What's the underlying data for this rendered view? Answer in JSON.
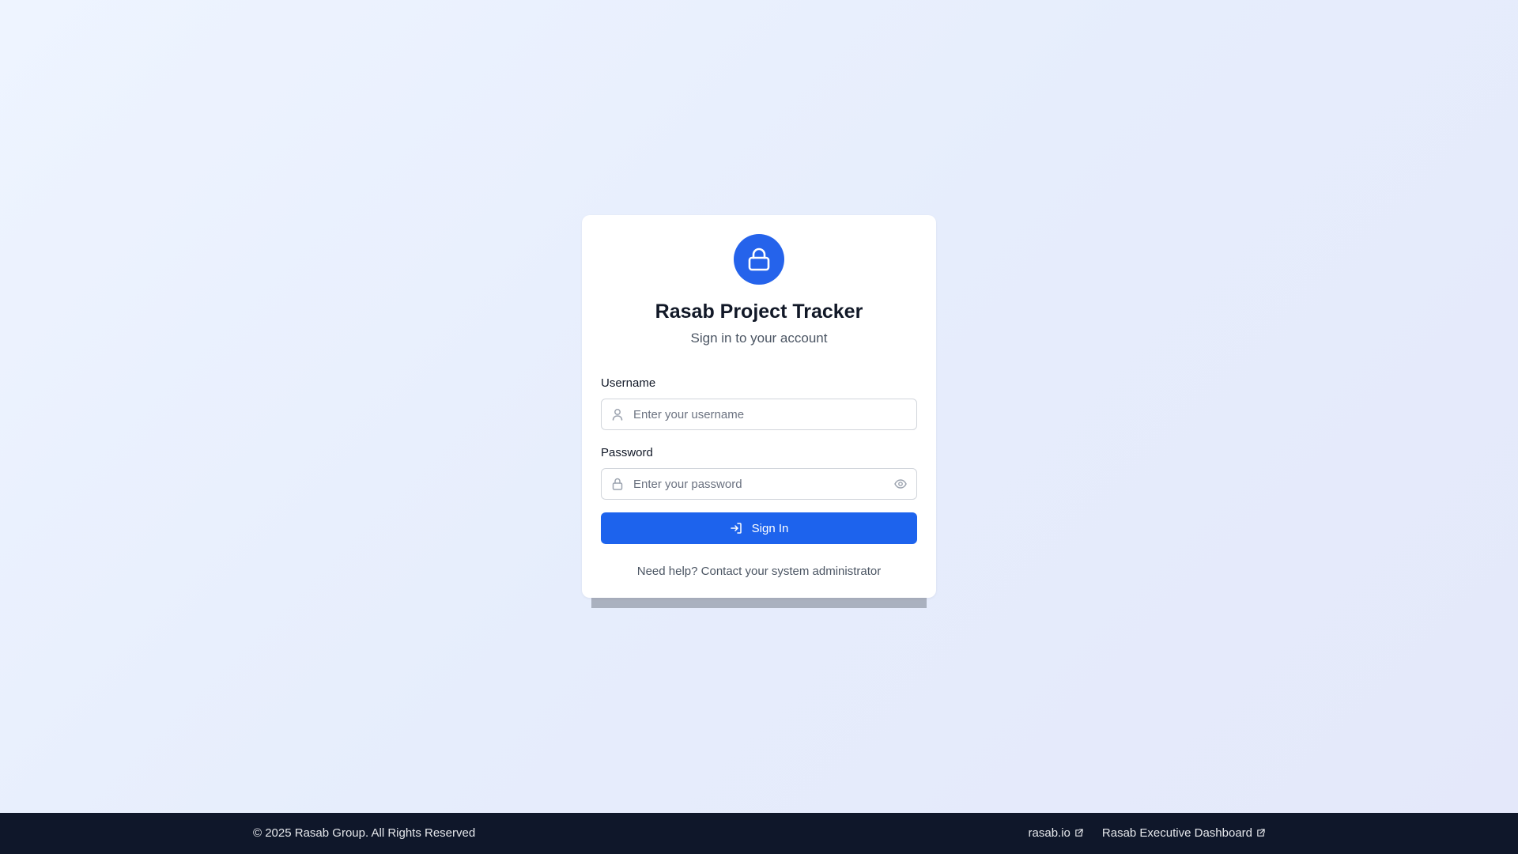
{
  "app": {
    "title": "Rasab Project Tracker",
    "subtitle": "Sign in to your account"
  },
  "form": {
    "username": {
      "label": "Username",
      "placeholder": "Enter your username",
      "value": ""
    },
    "password": {
      "label": "Password",
      "placeholder": "Enter your password",
      "value": ""
    },
    "submit_label": "Sign In",
    "help_text": "Need help? Contact your system administrator"
  },
  "footer": {
    "copyright": "© 2025 Rasab Group. All Rights Reserved",
    "links": [
      {
        "label": "rasab.io",
        "icon": "external-link-icon"
      },
      {
        "label": "Rasab Executive Dashboard",
        "icon": "external-link-icon"
      }
    ]
  },
  "icons": {
    "header": "lock-icon",
    "username": "user-icon",
    "password": "lock-icon",
    "toggle": "eye-icon",
    "submit": "sign-in-icon"
  },
  "colors": {
    "accent": "#2563eb",
    "button": "#1d63ed",
    "footer_bg": "#0f172a"
  }
}
